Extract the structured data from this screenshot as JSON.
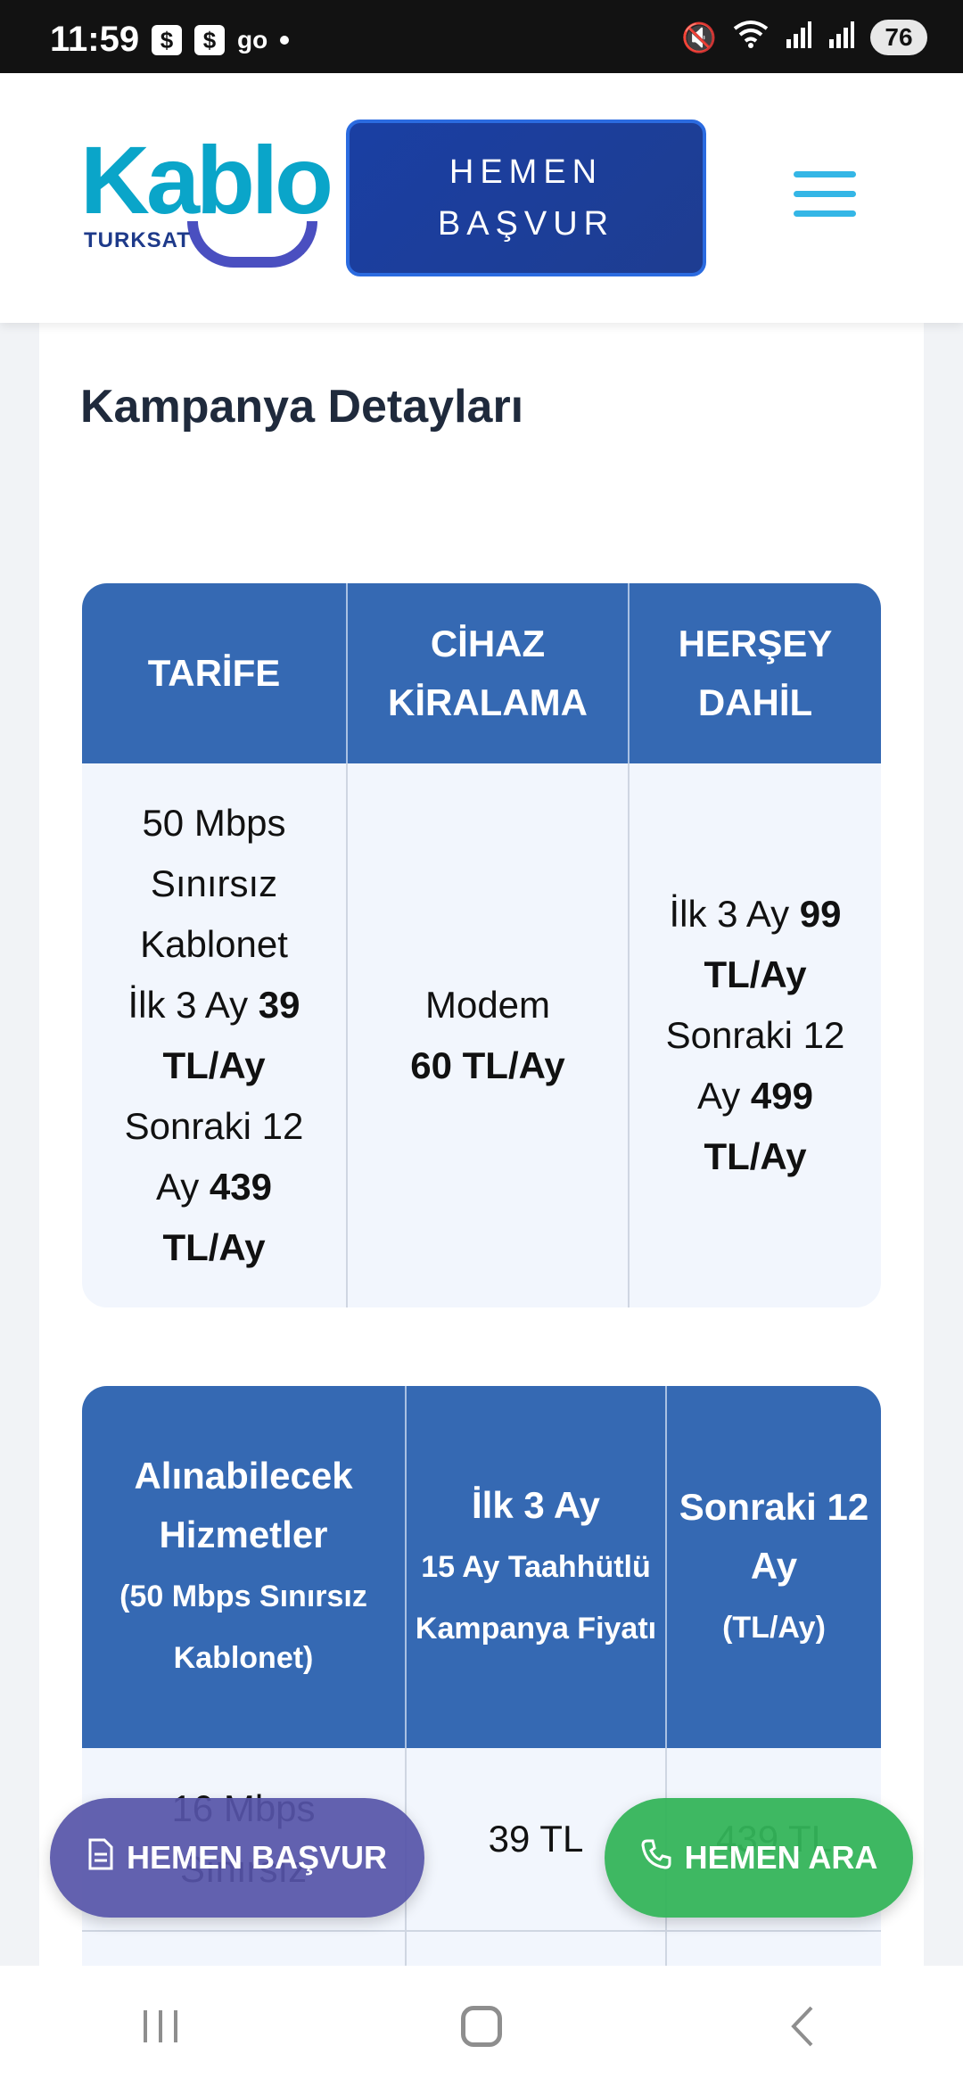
{
  "status_bar": {
    "time": "11:59",
    "notif_1": "$",
    "notif_2": "$",
    "notif_3": "go",
    "battery": "76",
    "icons": [
      "mute-icon",
      "wifi-icon",
      "signal-icon",
      "signal-icon"
    ]
  },
  "header": {
    "logo_text": "Kablo",
    "logo_sub": "TURKSAT",
    "apply_label": "HEMEN BAŞVUR",
    "menu_icon": "hamburger-menu-icon"
  },
  "section": {
    "title": "Kampanya Detayları"
  },
  "table1": {
    "headers": [
      "TARİFE",
      "CİHAZ KİRALAMA",
      "HERŞEY DAHİL"
    ],
    "col1": {
      "line1": "50 Mbps Sınırsız Kablonet",
      "line2_prefix": "İlk 3 Ay",
      "line2_bold": "39 TL/Ay",
      "line3_prefix": "Sonraki 12 Ay",
      "line3_bold": "439 TL/Ay"
    },
    "col2": {
      "line1": "Modem",
      "line2_bold": "60 TL/Ay"
    },
    "col3": {
      "line1_prefix": "İlk 3 Ay",
      "line1_bold": "99 TL/Ay",
      "line2_prefix": "Sonraki 12 Ay",
      "line2_bold": "499 TL/Ay"
    }
  },
  "table2": {
    "h1_main": "Alınabilecek Hizmetler",
    "h1_sub": "(50 Mbps Sınırsız Kablonet)",
    "h2_main": "İlk 3 Ay",
    "h2_sub": "15 Ay Taahhütlü Kampanya Fiyatı",
    "h3_main": "Sonraki 12 Ay",
    "h3_sub": "(TL/Ay)",
    "rows": [
      [
        "16 Mbps Sınırsız",
        "39 TL",
        "439 TL"
      ]
    ]
  },
  "floating": {
    "apply_label": "HEMEN BAŞVUR",
    "call_label": "HEMEN ARA"
  },
  "colors": {
    "header_blue": "#3569b3",
    "apply_fab": "#5654a8",
    "call_fab": "#34b45a",
    "logo_cyan": "#0aa5c9"
  }
}
